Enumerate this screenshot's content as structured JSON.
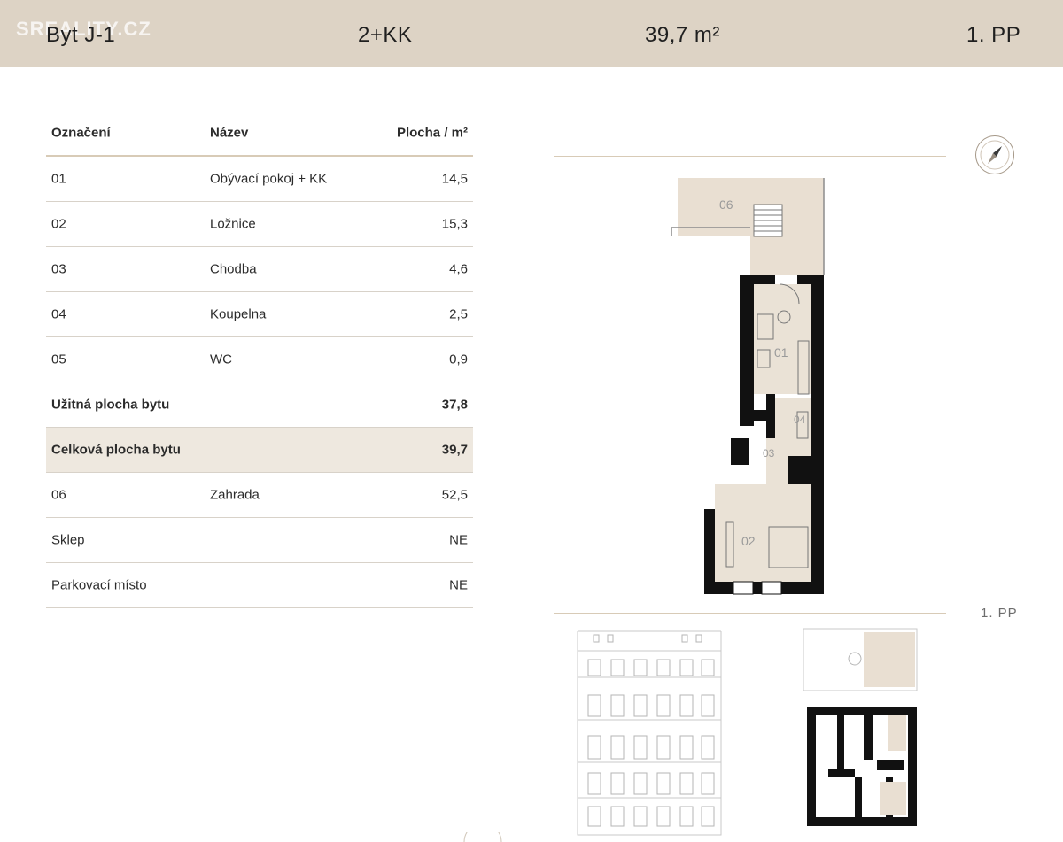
{
  "header": {
    "unit": "Byt J-1",
    "layout": "2+KK",
    "area": "39,7 m²",
    "floor": "1. PP",
    "watermark": "SREALITY.CZ"
  },
  "table": {
    "columns": [
      "Označení",
      "Název",
      "Plocha / m²"
    ],
    "rows": [
      {
        "id": "01",
        "name": "Obývací pokoj + KK",
        "area": "14,5"
      },
      {
        "id": "02",
        "name": "Ložnice",
        "area": "15,3"
      },
      {
        "id": "03",
        "name": "Chodba",
        "area": "4,6"
      },
      {
        "id": "04",
        "name": "Koupelna",
        "area": "2,5"
      },
      {
        "id": "05",
        "name": "WC",
        "area": "0,9"
      }
    ],
    "usable": {
      "label": "Užitná plocha bytu",
      "area": "37,8"
    },
    "total": {
      "label": "Celková plocha bytu",
      "area": "39,7"
    },
    "extra": [
      {
        "id": "06",
        "name": "Zahrada",
        "area": "52,5"
      },
      {
        "id": "Sklep",
        "name": "",
        "area": "NE"
      },
      {
        "id": "Parkovací místo",
        "name": "",
        "area": "NE"
      }
    ]
  },
  "plan": {
    "floor_label": "1. PP",
    "room_labels": [
      "06",
      "01",
      "04",
      "03",
      "02"
    ]
  },
  "colors": {
    "header_bg": "#ddd3c5",
    "highlight_bg": "#eee8df",
    "garden": "#e9dfd2",
    "wall": "#111111"
  }
}
